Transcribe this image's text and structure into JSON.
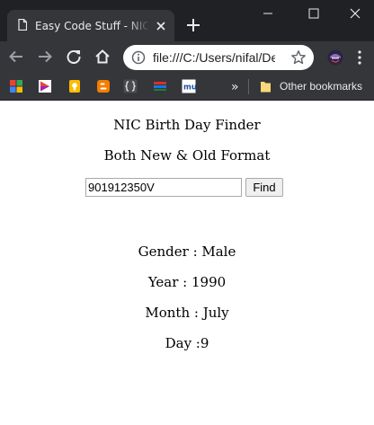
{
  "browser": {
    "tab_title": "Easy Code Stuff - NIC Birth Day Finder",
    "address": "file:///C:/Users/nifal/Desktop/nic.html",
    "bookmarks_overflow": "»",
    "other_bookmarks_label": "Other bookmarks"
  },
  "icons": {
    "tab_favicon": "document-icon",
    "tab_close": "close-icon",
    "new_tab": "plus-icon",
    "back": "arrow-left-icon",
    "forward": "arrow-right-icon",
    "reload": "reload-icon",
    "home": "home-icon",
    "site_info": "info-icon",
    "bookmark_star": "star-icon",
    "extension": "ninja-avatar-icon",
    "menu": "kebab-menu-icon"
  },
  "page": {
    "heading": "NIC Birth Day Finder",
    "subheading": "Both New & Old Format",
    "nic_value": "901912350V",
    "find_label": "Find",
    "gender": "Gender : Male",
    "year": "Year : 1990",
    "month": "Month : July",
    "day": "Day :9"
  },
  "colors": {
    "tabstrip_bg": "#202124",
    "toolbar_bg": "#35363a",
    "page_bg": "#ffffff"
  }
}
